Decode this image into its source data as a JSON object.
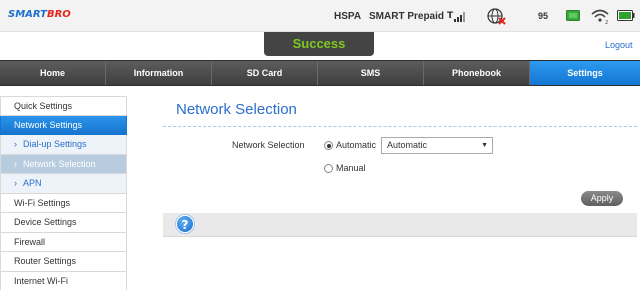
{
  "header": {
    "logo_smart": "SMART",
    "logo_bro": "BRO",
    "network_type": "HSPA",
    "carrier": "SMART Prepaid",
    "battery_value": "95"
  },
  "banner": {
    "success": "Success"
  },
  "logout_label": "Logout",
  "nav": {
    "items": [
      "Home",
      "Information",
      "SD Card",
      "SMS",
      "Phonebook",
      "Settings"
    ],
    "active": "Settings"
  },
  "sidebar": {
    "items": [
      {
        "label": "Quick Settings"
      },
      {
        "label": "Network Settings"
      },
      {
        "label": "Dial-up Settings"
      },
      {
        "label": "Network Selection"
      },
      {
        "label": "APN"
      },
      {
        "label": "Wi-Fi Settings"
      },
      {
        "label": "Device Settings"
      },
      {
        "label": "Firewall"
      },
      {
        "label": "Router Settings"
      },
      {
        "label": "Internet Wi-Fi"
      }
    ],
    "sub_arrow": "›"
  },
  "main": {
    "title": "Network Selection",
    "form_label": "Network Selection",
    "option_automatic": "Automatic",
    "option_manual": "Manual",
    "selected_mode": "Automatic",
    "select_value": "Automatic",
    "apply_label": "Apply",
    "help_glyph": "?"
  },
  "colors": {
    "accent_blue": "#1b82e0",
    "success_green": "#7ec81f",
    "logo_red": "#e1261c"
  },
  "icons": {
    "signal": "signal-bars-icon",
    "globe": "globe-disconnected-icon",
    "sms": "sms-icon",
    "wifi": "wifi-icon",
    "battery": "battery-icon",
    "help": "help-icon"
  }
}
